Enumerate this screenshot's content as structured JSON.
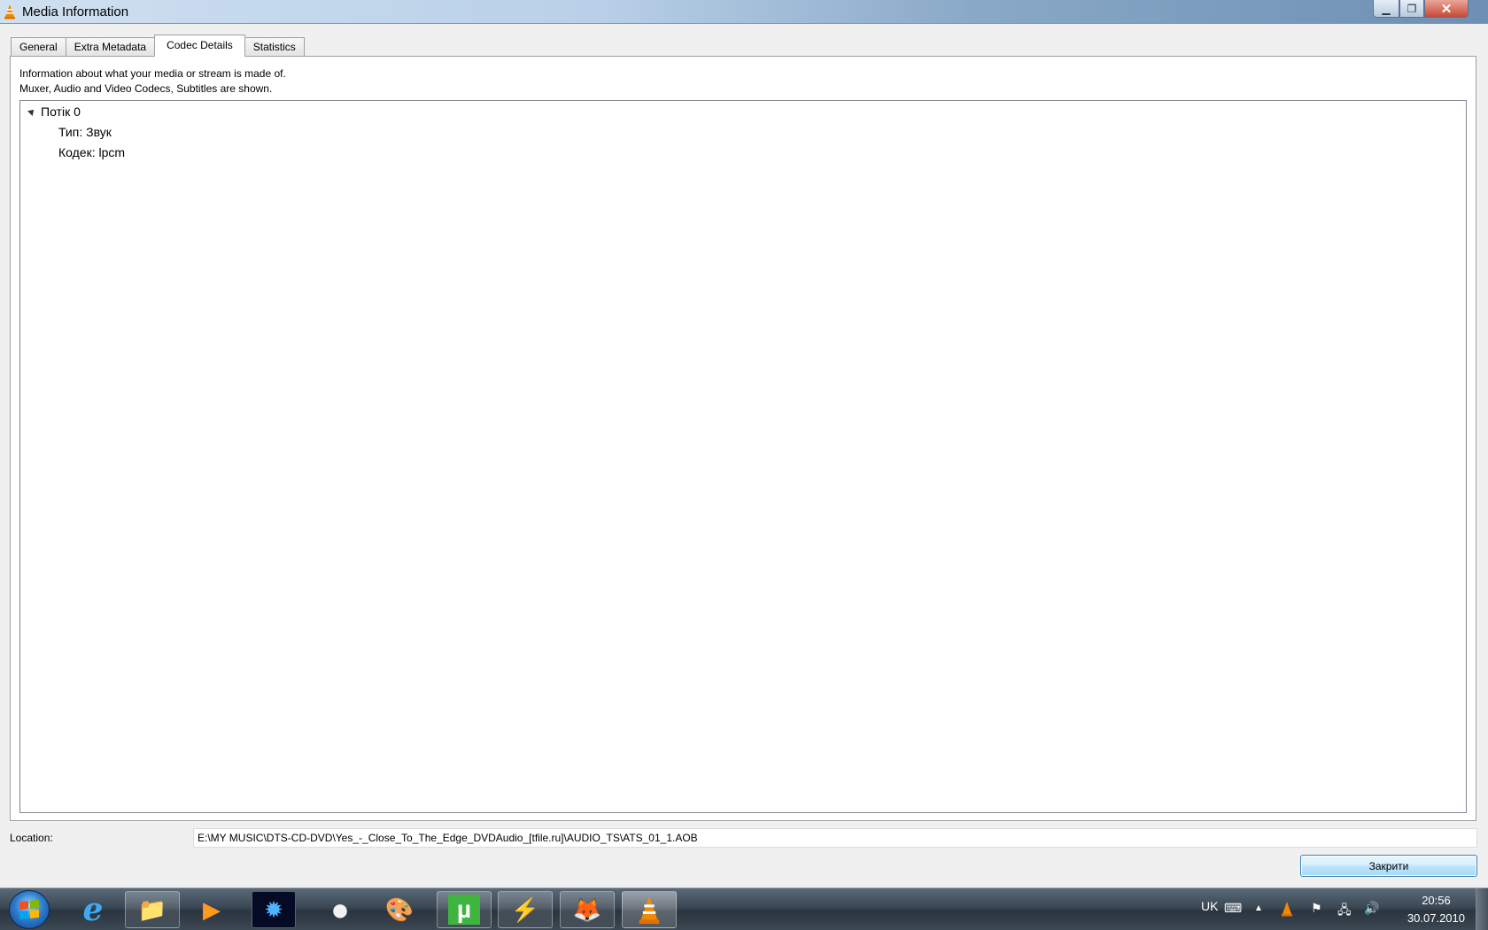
{
  "window": {
    "title": "Media Information",
    "close_glyph": "✕",
    "max_glyph": "❐",
    "min_glyph": "▁"
  },
  "tabs": [
    {
      "label": "General"
    },
    {
      "label": "Extra Metadata"
    },
    {
      "label": "Codec Details",
      "active": true
    },
    {
      "label": "Statistics"
    }
  ],
  "codec": {
    "description_line1": "Information about what your media or stream is made of.",
    "description_line2": "Muxer, Audio and Video Codecs, Subtitles are shown.",
    "tree": {
      "stream_label": "Потік 0",
      "type_label": "Тип: Звук",
      "codec_label": "Кодек: lpcm"
    }
  },
  "location": {
    "label": "Location:",
    "value": "E:\\MY MUSIC\\DTS-CD-DVD\\Yes_-_Close_To_The_Edge_DVDAudio_[tfile.ru]\\AUDIO_TS\\ATS_01_1.AOB"
  },
  "buttons": {
    "close_label": "Закрити"
  },
  "taskbar": {
    "apps": [
      {
        "name": "internet-explorer",
        "glyph": "e"
      },
      {
        "name": "file-explorer",
        "glyph": "📁"
      },
      {
        "name": "media-player",
        "glyph": "▶"
      },
      {
        "name": "visualizer",
        "glyph": "✹"
      },
      {
        "name": "sphere-app",
        "glyph": "●"
      },
      {
        "name": "paint",
        "glyph": "🎨"
      },
      {
        "name": "utorrent",
        "glyph": "µ"
      },
      {
        "name": "winamp",
        "glyph": "⚡"
      },
      {
        "name": "firefox",
        "glyph": "🦊"
      },
      {
        "name": "vlc",
        "glyph": "▲"
      }
    ],
    "language": "UK",
    "clock_time": "20:56",
    "clock_date": "30.07.2010"
  },
  "colors": {
    "accent": "#3c7fb1",
    "vlc_orange": "#f08a00"
  }
}
